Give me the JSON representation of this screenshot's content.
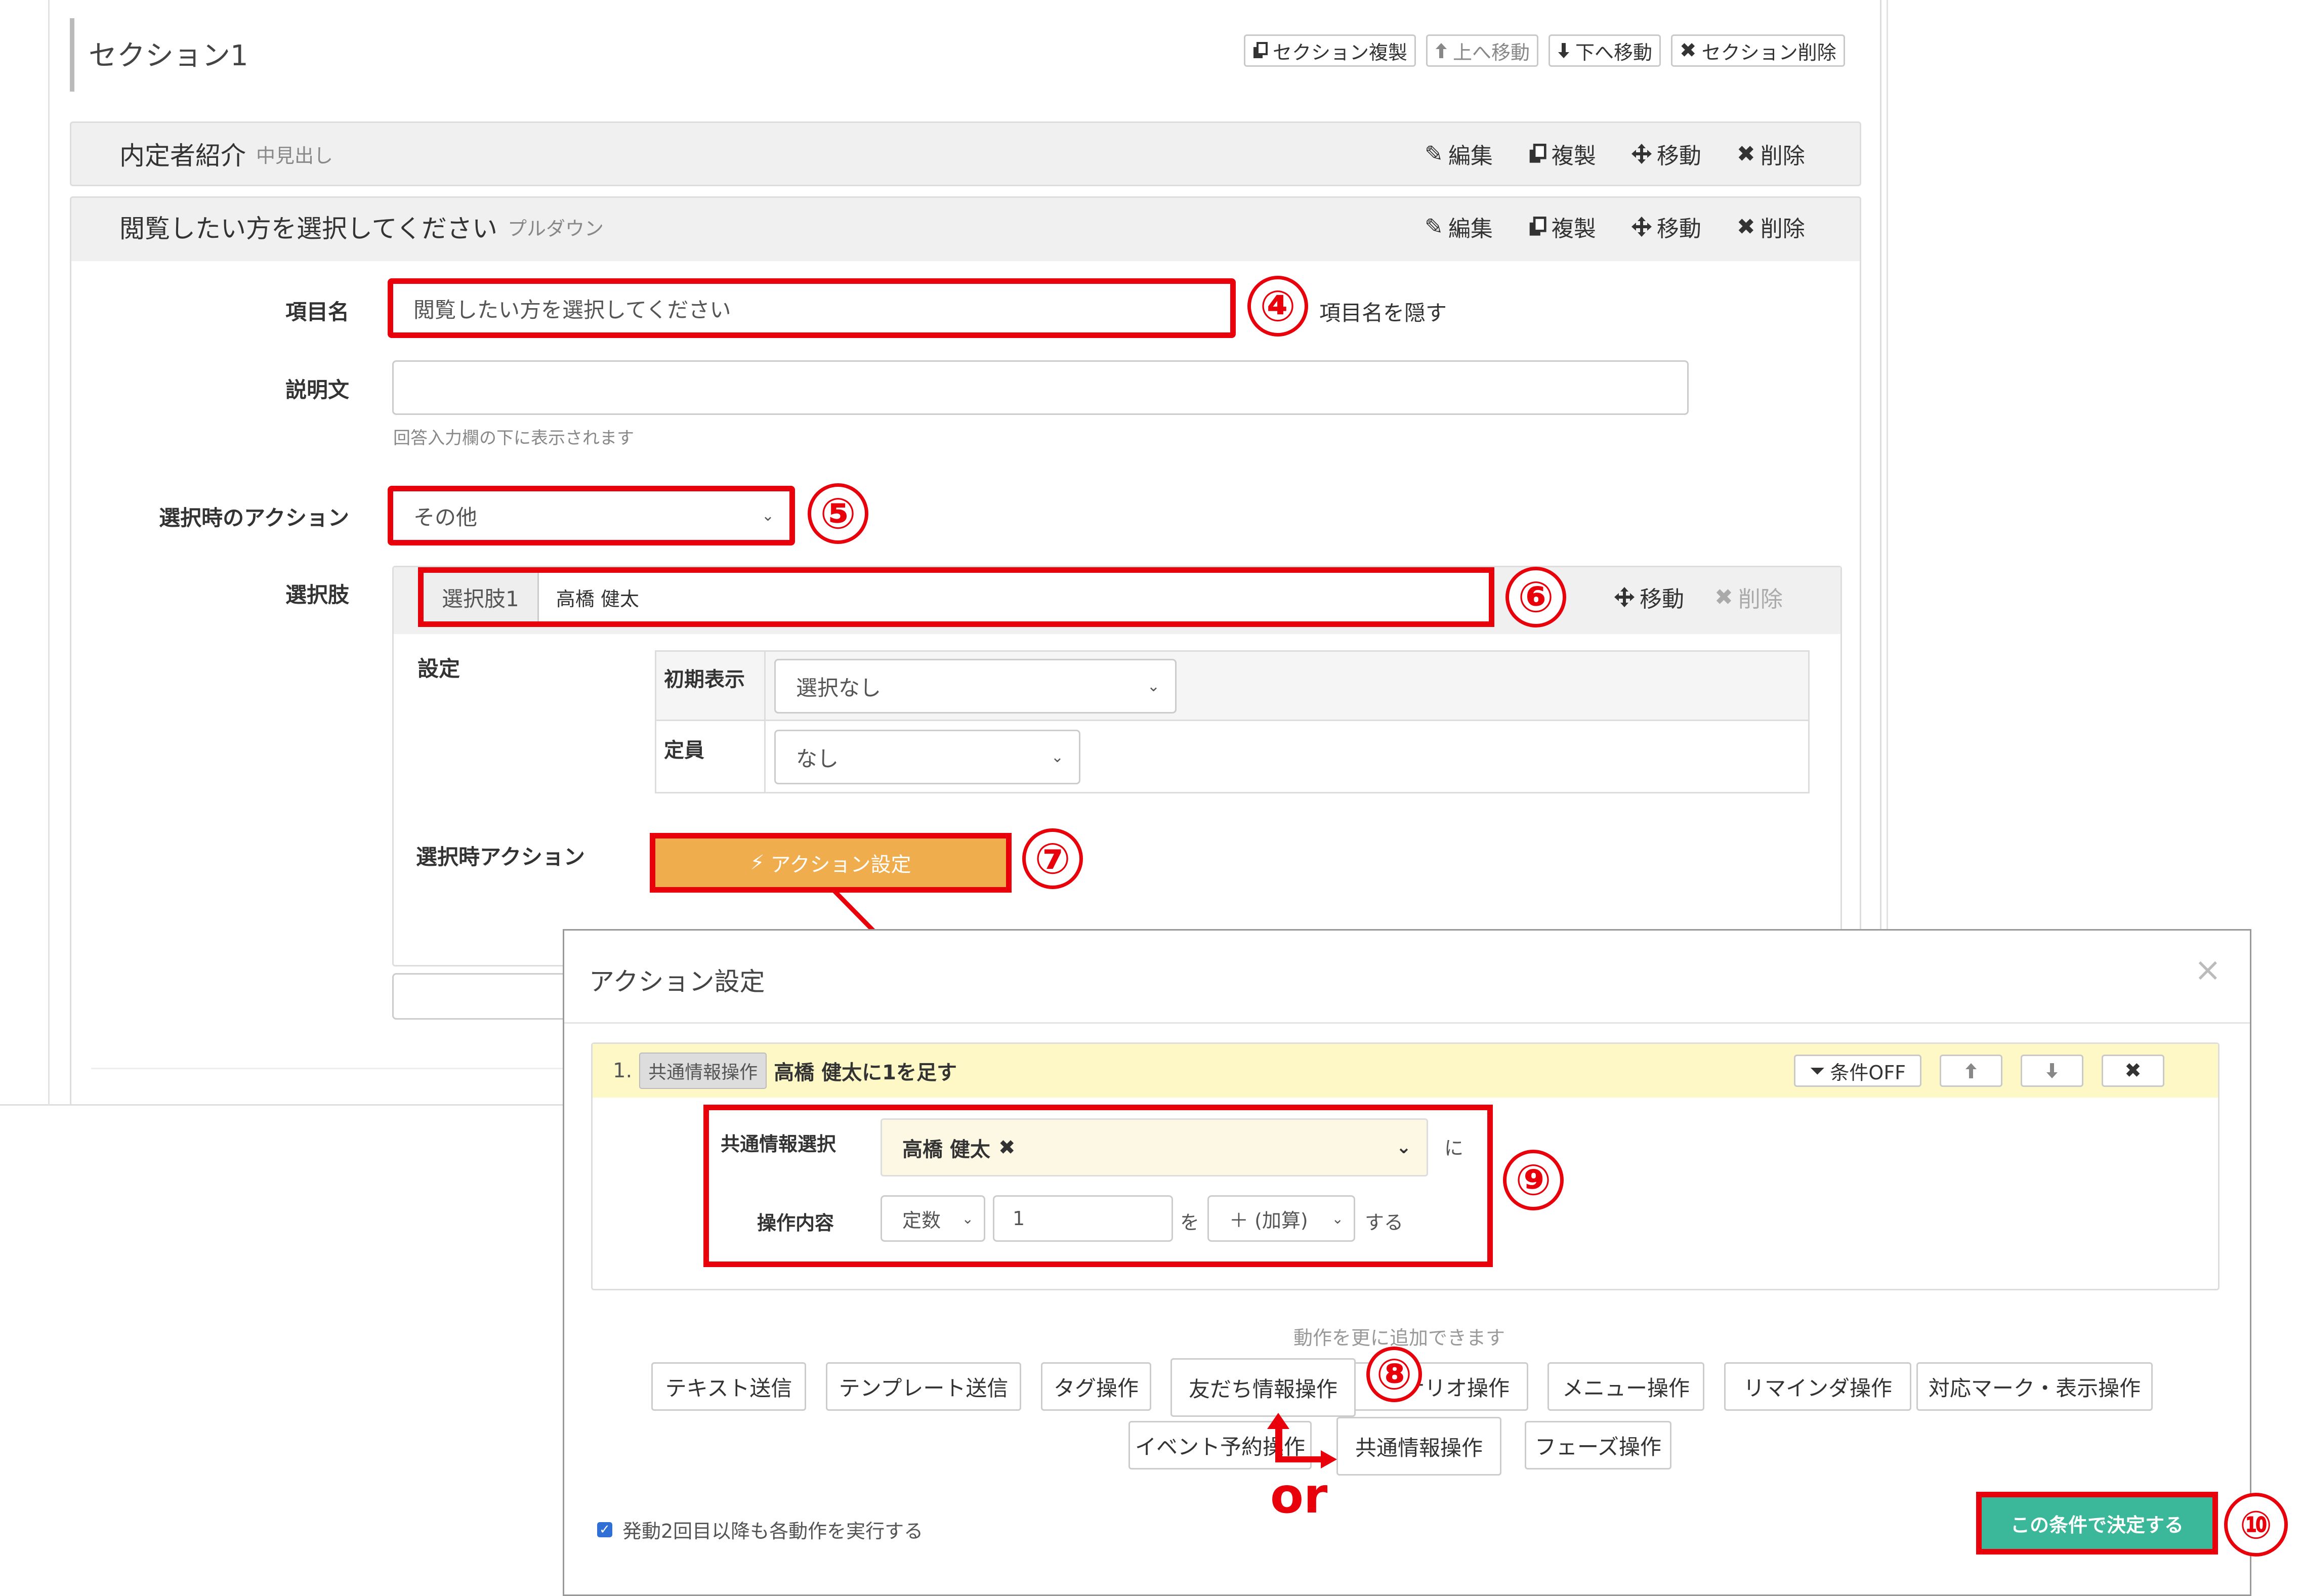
{
  "section": {
    "title": "セクション1",
    "buttons": {
      "copy": "セクション複製",
      "up": "上へ移動",
      "down": "下へ移動",
      "delete": "セクション削除"
    }
  },
  "row_tools": {
    "edit": "編集",
    "copy": "複製",
    "move": "移動",
    "delete": "削除"
  },
  "item1": {
    "title": "内定者紹介",
    "type": "中見出し"
  },
  "item2": {
    "title": "閲覧したい方を選択してください",
    "type": "プルダウン"
  },
  "form": {
    "item_name_label": "項目名",
    "item_name_value": "閲覧したい方を選択してください",
    "hide_label": "項目名を隠す",
    "desc_label": "説明文",
    "desc_hint": "回答入力欄の下に表示されます",
    "action_label": "選択時のアクション",
    "action_value": "その他",
    "choices_label": "選択肢",
    "choice_tag": "選択肢1",
    "choice_value": "高橋 健太",
    "choice_move": "移動",
    "choice_delete": "削除",
    "settings_label": "設定",
    "initial_label": "初期表示",
    "initial_value": "選択なし",
    "capacity_label": "定員",
    "capacity_value": "なし",
    "on_select_label": "選択時アクション",
    "action_btn": "アクション設定"
  },
  "modal": {
    "title": "アクション設定",
    "close": "×",
    "action_index": "1.",
    "action_tag": "共通情報操作",
    "action_desc": "高橋 健太に1を足す",
    "cond_btn": "条件OFF",
    "select_label": "共通情報選択",
    "select_value": "高橋 健太",
    "ni": "に",
    "op_label": "操作内容",
    "op_type": "定数",
    "op_value": "1",
    "wo": "を",
    "op_calc": "＋ (加算)",
    "suru": "する",
    "add_hint": "動作を更に追加できます",
    "action_buttons_row1": [
      "テキスト送信",
      "テンプレート送信",
      "タグ操作",
      "友だち情報操作",
      "シナリオ操作",
      "メニュー操作",
      "リマインダ操作",
      "対応マーク・表示操作"
    ],
    "action_buttons_row2": [
      "イベント予約操作",
      "共通情報操作",
      "フェーズ操作"
    ],
    "checkbox_label": "発動2回目以降も各動作を実行する",
    "submit": "この条件で決定する"
  },
  "annotations": {
    "n4": "④",
    "n5": "⑤",
    "n6": "⑥",
    "n7": "⑦",
    "n8": "⑧",
    "n9": "⑨",
    "n10": "⑩",
    "or": "or"
  },
  "colors": {
    "accent_red": "#e8000b",
    "action_orange": "#f0ad4e",
    "submit_green": "#3bb79a",
    "highlight_yellow": "#fdf8c5"
  }
}
